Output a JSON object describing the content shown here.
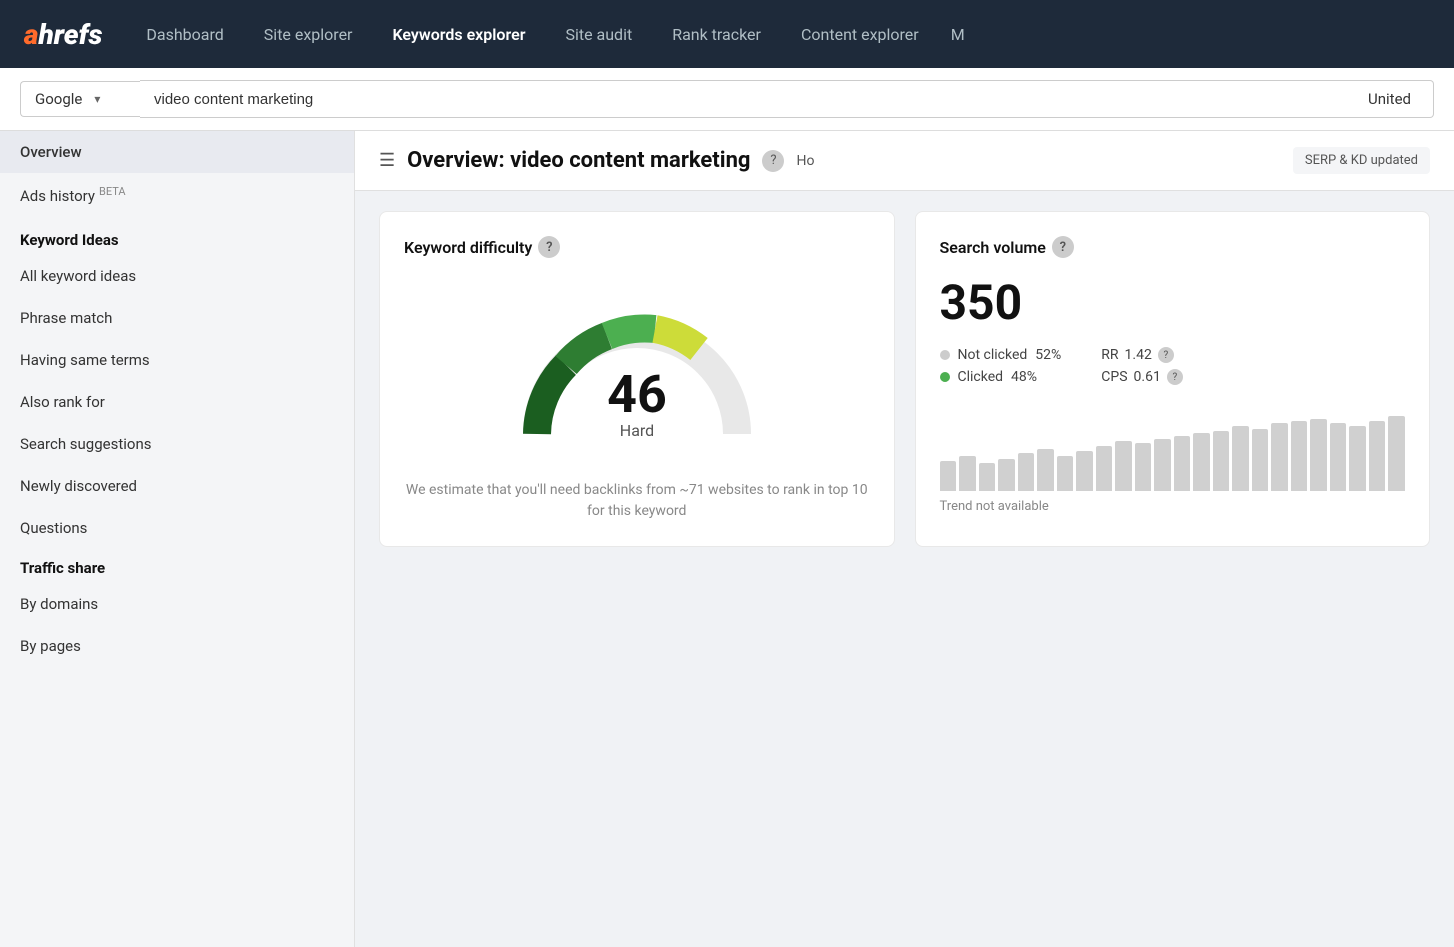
{
  "nav": {
    "logo_a": "a",
    "logo_hrefs": "hrefs",
    "items": [
      {
        "label": "Dashboard",
        "active": false
      },
      {
        "label": "Site explorer",
        "active": false
      },
      {
        "label": "Keywords explorer",
        "active": true
      },
      {
        "label": "Site audit",
        "active": false
      },
      {
        "label": "Rank tracker",
        "active": false
      },
      {
        "label": "Content explorer",
        "active": false
      },
      {
        "label": "M",
        "active": false
      }
    ]
  },
  "search": {
    "engine": "Google",
    "query": "video content marketing",
    "country": "United"
  },
  "sidebar": {
    "overview": "Overview",
    "ads_history": "Ads history",
    "ads_history_badge": "BETA",
    "keyword_ideas_header": "Keyword Ideas",
    "all_keyword_ideas": "All keyword ideas",
    "phrase_match": "Phrase match",
    "having_same_terms": "Having same terms",
    "also_rank_for": "Also rank for",
    "search_suggestions": "Search suggestions",
    "newly_discovered": "Newly discovered",
    "questions": "Questions",
    "traffic_share_header": "Traffic share",
    "by_domains": "By domains",
    "by_pages": "By pages"
  },
  "page_header": {
    "title": "Overview: video content marketing",
    "help_icon": "?",
    "ho_text": "Ho",
    "serp_badge": "SERP & KD updated"
  },
  "keyword_difficulty_card": {
    "title": "Keyword difficulty",
    "score": "46",
    "label": "Hard",
    "description": "We estimate that you'll need backlinks from ~71 websites to rank in top 10 for this keyword",
    "gauge_value": 46,
    "segments": [
      {
        "color": "#2e7d32",
        "start": 0,
        "end": 10
      },
      {
        "color": "#388e3c",
        "start": 10,
        "end": 20
      },
      {
        "color": "#558b2f",
        "start": 20,
        "end": 30
      },
      {
        "color": "#8bc34a",
        "start": 30,
        "end": 40
      },
      {
        "color": "#cddc39",
        "start": 40,
        "end": 50
      }
    ]
  },
  "search_volume_card": {
    "title": "Search volume",
    "volume": "350",
    "not_clicked_label": "Not clicked",
    "not_clicked_pct": "52%",
    "clicked_label": "Clicked",
    "clicked_pct": "48%",
    "rr_label": "RR",
    "rr_value": "1.42",
    "cps_label": "CPS",
    "cps_value": "0.61",
    "trend_label": "Trend not available",
    "bars": [
      30,
      35,
      28,
      32,
      38,
      42,
      35,
      40,
      45,
      50,
      48,
      52,
      55,
      58,
      60,
      65,
      62,
      68,
      70,
      72,
      68,
      65,
      70,
      75
    ]
  }
}
